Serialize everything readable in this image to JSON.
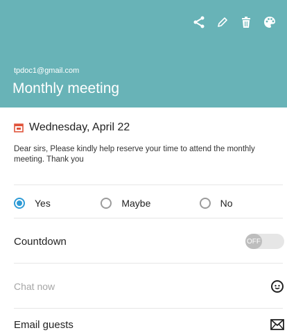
{
  "header": {
    "email": "tpdoc1@gmail.com",
    "title": "Monthly meeting",
    "actions": [
      {
        "icon": "share-icon"
      },
      {
        "icon": "edit-icon"
      },
      {
        "icon": "trash-icon"
      },
      {
        "icon": "palette-icon"
      }
    ]
  },
  "event": {
    "date": "Wednesday, April 22",
    "description": "Dear sirs, Please kindly help reserve your time to attend the monthly meeting. Thank you"
  },
  "rsvp": {
    "options": [
      "Yes",
      "Maybe",
      "No"
    ],
    "selected": "Yes"
  },
  "settings": {
    "countdown_label": "Countdown",
    "countdown_toggle_text": "OFF",
    "chat_label": "Chat now",
    "email_guests_label": "Email guests"
  },
  "colors": {
    "header": "#68b3b7",
    "accent": "#2f9bd6",
    "calendar_icon": "#e0543b"
  }
}
